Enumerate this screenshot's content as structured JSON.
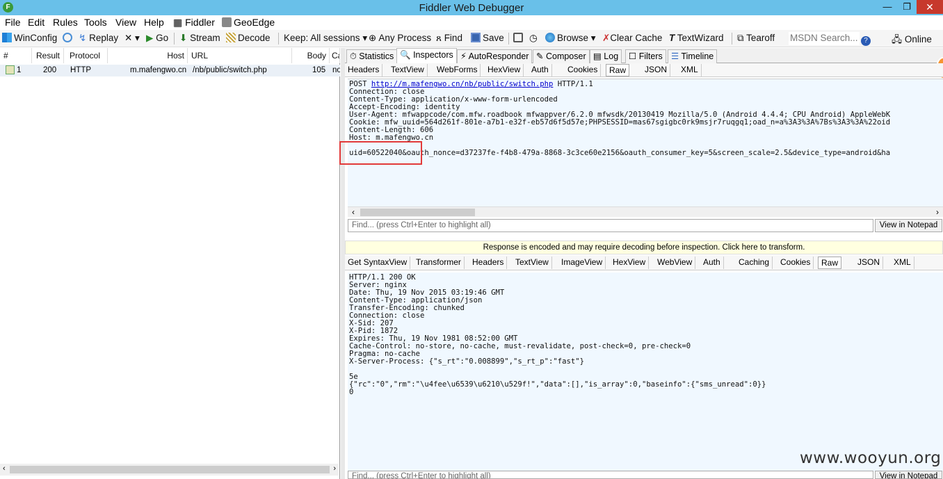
{
  "window": {
    "title": "Fiddler Web Debugger",
    "app_icon": "F",
    "min": "—",
    "max": "❐",
    "close": "✕"
  },
  "menu": [
    "File",
    "Edit",
    "Rules",
    "Tools",
    "View",
    "Help",
    "Fiddler",
    "GeoEdge"
  ],
  "toolbar": {
    "winconfig": "WinConfig",
    "replay": "Replay",
    "remove": "✕ ▾",
    "go": "Go",
    "stream": "Stream",
    "decode": "Decode",
    "keep": "Keep: All sessions ▾",
    "process": "Any Process",
    "find": "Find",
    "save": "Save",
    "browse": "Browse ▾",
    "clear_cache": "Clear Cache",
    "textwizard": "TextWizard",
    "tearoff": "Tearoff",
    "search_placeholder": "MSDN Search...",
    "online": "Online"
  },
  "sessions": {
    "columns": [
      "#",
      "Result",
      "Protocol",
      "Host",
      "URL",
      "Body",
      "Ca"
    ],
    "rows": [
      {
        "num": "1",
        "result": "200",
        "protocol": "HTTP",
        "host": "m.mafengwo.cn",
        "url": "/nb/public/switch.php",
        "body": "105",
        "ca": "no"
      }
    ]
  },
  "inspector_tabs": [
    "Statistics",
    "Inspectors",
    "AutoResponder",
    "Composer",
    "Log",
    "Filters",
    "Timeline"
  ],
  "request": {
    "tabs": [
      "Headers",
      "TextView",
      "WebForms",
      "HexView",
      "Auth",
      "Cookies",
      "Raw",
      "JSON",
      "XML"
    ],
    "line1_prefix": "POST ",
    "url": "http://m.mafengwo.cn/nb/public/switch.php",
    "line1_suffix": " HTTP/1.1",
    "headers": "Connection: close\nContent-Type: application/x-www-form-urlencoded\nAccept-Encoding: identity\nUser-Agent: mfwappcode/com.mfw.roadbook mfwappver/6.2.0 mfwsdk/20130419 Mozilla/5.0 (Android 4.4.4; CPU Android) AppleWebK\nCookie: mfw_uuid=564d261f-801e-a7b1-e32f-eb57d6f5d57e;PHPSESSID=mas67sgigbc0rk9msjr7ruqgq1;oad_n=a%3A3%3A%7Bs%3A3%3A%22oid\nContent-Length: 606\nHost: m.mafengwo.cn",
    "body": "uid=60522040&oauth_nonce=d37237fe-f4b8-479a-8868-3c3ce60e2156&oauth_consumer_key=5&screen_scale=2.5&device_type=android&ha",
    "find_placeholder": "Find... (press Ctrl+Enter to highlight all)",
    "view_notepad": "View in Notepad"
  },
  "banner": "Response is encoded and may require decoding before inspection. Click here to transform.",
  "response": {
    "tabs": [
      "Get SyntaxView",
      "Transformer",
      "Headers",
      "TextView",
      "ImageView",
      "HexView",
      "WebView",
      "Auth",
      "Caching",
      "Cookies",
      "Raw",
      "JSON",
      "XML"
    ],
    "text": "HTTP/1.1 200 OK\nServer: nginx\nDate: Thu, 19 Nov 2015 03:19:46 GMT\nContent-Type: application/json\nTransfer-Encoding: chunked\nConnection: close\nX-Sid: 207\nX-Pid: 1872\nExpires: Thu, 19 Nov 1981 08:52:00 GMT\nCache-Control: no-store, no-cache, must-revalidate, post-check=0, pre-check=0\nPragma: no-cache\nX-Server-Process: {\"s_rt\":\"0.008899\",\"s_rt_p\":\"fast\"}\n\n5e\n{\"rc\":\"0\",\"rm\":\"\\u4fee\\u6539\\u6210\\u529f!\",\"data\":[],\"is_array\":0,\"baseinfo\":{\"sms_unread\":0}}\n0",
    "find_placeholder": "Find... (press Ctrl+Enter to highlight all)",
    "view_notepad": "View in Notepad"
  },
  "watermark": "www.wooyun.org",
  "colors": {
    "titlebar": "#69c0e9",
    "close": "#c7392c",
    "highlight": "#e23a3a",
    "banner": "#ffffe0",
    "text_bg": "#f0f8ff"
  }
}
